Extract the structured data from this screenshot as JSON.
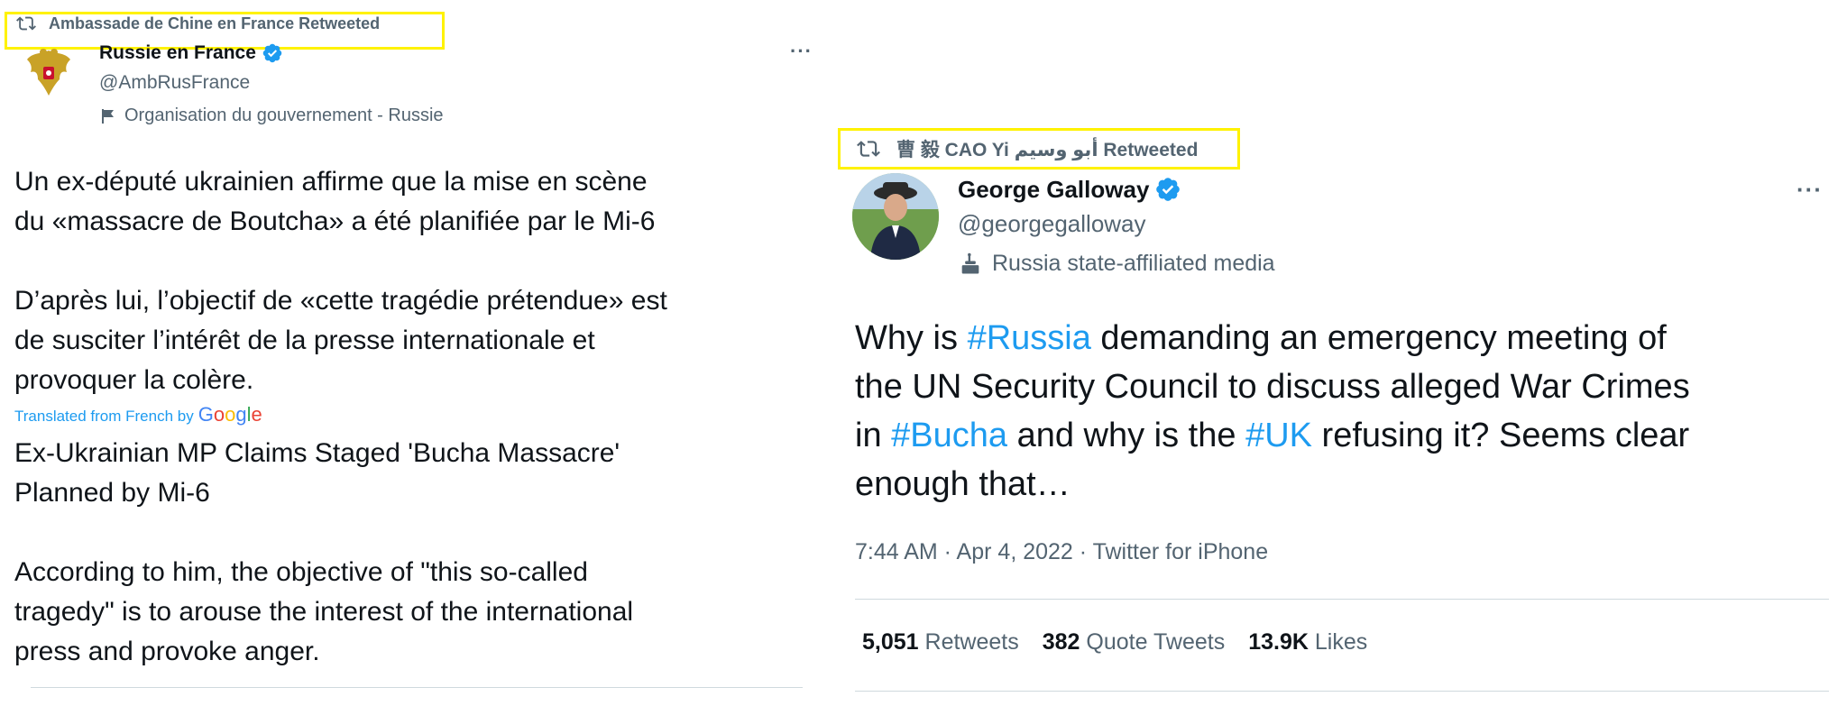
{
  "left_tweet": {
    "retweet_by": "Ambassade de Chine en France Retweeted",
    "author_name": "Russie en France",
    "handle": "@AmbRusFrance",
    "label": "Organisation du gouvernement - Russie",
    "more": "···",
    "text_original": "Un ex-député ukrainien affirme que la mise en scène\ndu «massacre de Boutcha» a été planifiée par le Mi-6\n\nD’après lui, l’objectif de «cette tragédie prétendue» est\nde susciter l’intérêt de la presse internationale et\nprovoquer la colère.",
    "translated_from": "Translated from French by",
    "google": "Google",
    "text_translated": "Ex-Ukrainian MP Claims Staged 'Bucha Massacre'\nPlanned by Mi-6\n\n According to him, the objective of \"this so-called\ntragedy\" is to arouse the interest of the international\npress and provoke anger."
  },
  "right_tweet": {
    "retweet_by": "曹 毅 CAO Yi أبو وسيم Retweeted",
    "author_name": "George Galloway",
    "handle": "@georgegalloway",
    "label": "Russia state-affiliated media",
    "more": "···",
    "text": {
      "p1": "Why is ",
      "tag1": "#Russia",
      "p2": " demanding an emergency meeting of\nthe UN Security Council to discuss alleged War Crimes\nin ",
      "tag2": "#Bucha",
      "p3": " and why is the ",
      "tag3": "#UK",
      "p4": " refusing it? Seems clear\nenough that…"
    },
    "meta": "7:44 AM · Apr 4, 2022 · Twitter for iPhone",
    "stats": {
      "retweets_count": "5,051",
      "retweets_label": "Retweets",
      "quotes_count": "382",
      "quotes_label": "Quote Tweets",
      "likes_count": "13.9K",
      "likes_label": "Likes"
    }
  },
  "colors": {
    "highlight": "#fff200",
    "link": "#1d9bf0",
    "muted": "#536471",
    "verified": "#1d9bf0"
  }
}
